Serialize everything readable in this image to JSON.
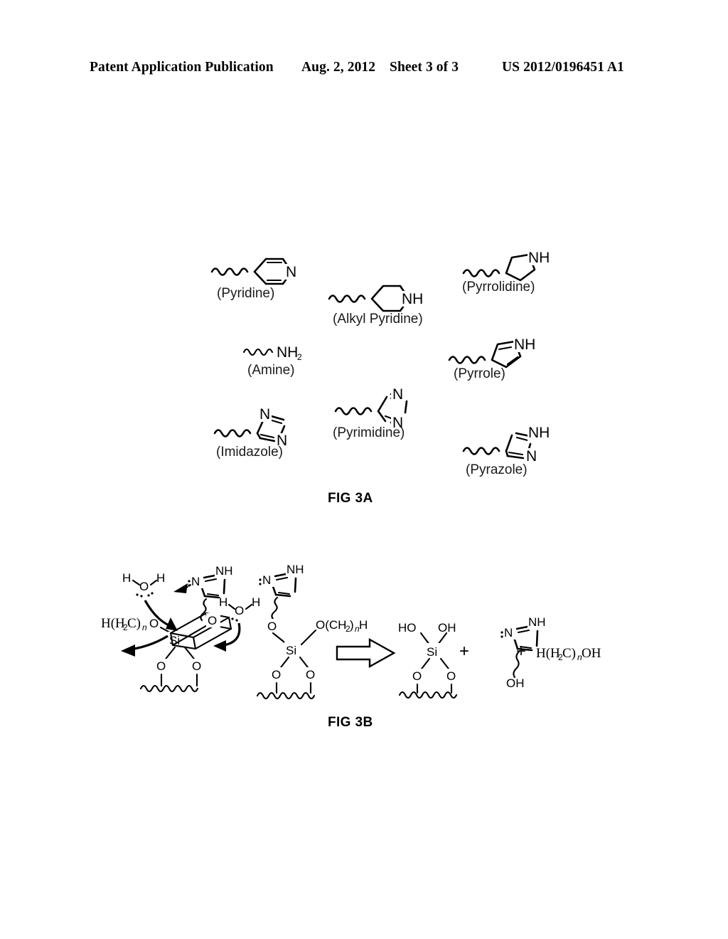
{
  "header": {
    "publication": "Patent Application Publication",
    "date": "Aug. 2, 2012",
    "sheet": "Sheet 3 of 3",
    "patent_number": "US 2012/0196451 A1"
  },
  "figures": [
    {
      "id": "fig3a",
      "label": "FIG 3A"
    },
    {
      "id": "fig3b",
      "label": "FIG 3B"
    }
  ],
  "fig3a": {
    "label": "FIG 3A",
    "structures": [
      {
        "name": "pyridine",
        "caption": "(Pyridine)",
        "ring": "6-aromatic",
        "heteroatoms": [
          "N"
        ]
      },
      {
        "name": "alkyl-pyridine",
        "caption": "(Alkyl Pyridine)",
        "ring": "6-saturated",
        "heteroatoms": [
          "NH"
        ]
      },
      {
        "name": "pyrrolidine",
        "caption": "(Pyrrolidine)",
        "ring": "5-saturated",
        "heteroatoms": [
          "NH"
        ]
      },
      {
        "name": "amine",
        "caption": "(Amine)",
        "ring": "none",
        "heteroatoms": [
          "NH2"
        ]
      },
      {
        "name": "pyrrole",
        "caption": "(Pyrrole)",
        "ring": "5-aromatic",
        "heteroatoms": [
          "NH"
        ]
      },
      {
        "name": "imidazole",
        "caption": "(Imidazole)",
        "ring": "5-aromatic",
        "heteroatoms": [
          "N",
          "N"
        ]
      },
      {
        "name": "pyrimidine",
        "caption": "(Pyrimidine)",
        "ring": "6-aromatic",
        "heteroatoms": [
          "N",
          "N"
        ]
      },
      {
        "name": "pyrazole",
        "caption": "(Pyrazole)",
        "ring": "5-aromatic",
        "heteroatoms": [
          "NH",
          "N"
        ]
      }
    ],
    "atom_labels": {
      "n": "N",
      "nh": "NH",
      "nh2_main": "NH",
      "nh2_sub": "2"
    }
  },
  "fig3b": {
    "label": "FIG 3B",
    "reactant_left": {
      "alkoxy_label_main": "H(H",
      "alkoxy_sub_2": "2",
      "alkoxy_mid": "C)",
      "alkoxy_sub_n": "n",
      "alkoxy_o": "O",
      "silicon": "Si",
      "oxygen": "O",
      "water_h_left": "H",
      "water_o": "O",
      "water_h_right": "H",
      "imidazole_nh": "NH",
      "imidazole_n": "N"
    },
    "reactant_right": {
      "silicon": "Si",
      "oxygen": "O",
      "alkoxy_o": "O(CH",
      "alkoxy_sub_2": "2",
      "alkoxy_close": ")",
      "alkoxy_sub_n": "n",
      "alkoxy_h": "H",
      "water_h_left": "H",
      "water_o": "O",
      "water_h_right": "H",
      "imidazole_nh": "NH",
      "imidazole_n": "N"
    },
    "products": {
      "silanol": {
        "ho_left": "HO",
        "oh_right": "OH",
        "silicon": "Si",
        "oxygen": "O"
      },
      "imidazole": {
        "nh": "NH",
        "n": "N",
        "oh": "OH"
      },
      "alcohol": {
        "main": "H(H",
        "sub_2": "2",
        "mid": "C)",
        "sub_n": "n",
        "tail": "OH"
      },
      "plus_1": "+",
      "plus_2": "+"
    },
    "reaction_arrow": "hollow-right-arrow"
  },
  "colors": {
    "ink": "#000000",
    "paper": "#ffffff",
    "caption_ink": "#1a1a1a"
  }
}
